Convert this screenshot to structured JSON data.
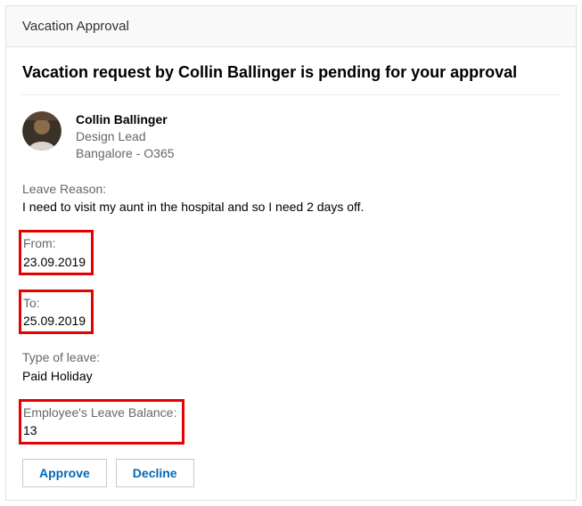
{
  "header": {
    "title": "Vacation Approval"
  },
  "headline": "Vacation request by Collin Ballinger is pending for your approval",
  "requester": {
    "name": "Collin Ballinger",
    "role": "Design Lead",
    "location": "Bangalore - O365"
  },
  "fields": {
    "reason": {
      "label": "Leave Reason:",
      "value": "I need to visit my aunt in the hospital and so I need 2 days off."
    },
    "from": {
      "label": "From:",
      "value": "23.09.2019"
    },
    "to": {
      "label": "To:",
      "value": "25.09.2019"
    },
    "leave_type": {
      "label": "Type of leave:",
      "value": "Paid Holiday"
    },
    "balance": {
      "label": "Employee's Leave Balance:",
      "value": "13"
    }
  },
  "actions": {
    "approve": "Approve",
    "decline": "Decline"
  }
}
